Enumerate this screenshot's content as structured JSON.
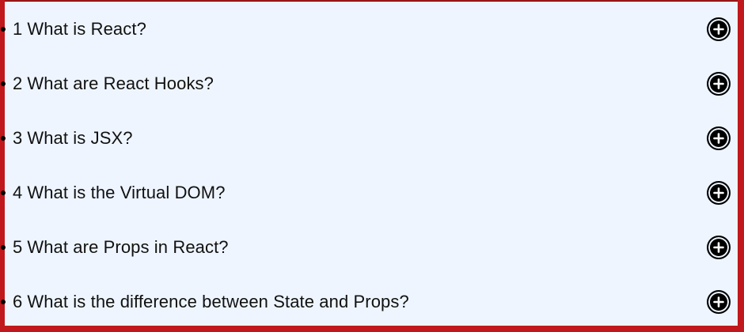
{
  "faq": {
    "items": [
      {
        "number": "1",
        "question": "What is React?",
        "toggle_icon": "plus-circle-icon"
      },
      {
        "number": "2",
        "question": "What are React Hooks?",
        "toggle_icon": "plus-circle-icon"
      },
      {
        "number": "3",
        "question": "What is JSX?",
        "toggle_icon": "plus-circle-icon"
      },
      {
        "number": "4",
        "question": "What is the Virtual DOM?",
        "toggle_icon": "plus-circle-icon"
      },
      {
        "number": "5",
        "question": "What are Props in React?",
        "toggle_icon": "plus-circle-icon"
      },
      {
        "number": "6",
        "question": "What is the difference between State and Props?",
        "toggle_icon": "plus-circle-icon"
      }
    ]
  },
  "colors": {
    "frame": "#c0181c",
    "panel_background": "#eef5ff",
    "text": "#111111",
    "icon": "#000000"
  }
}
